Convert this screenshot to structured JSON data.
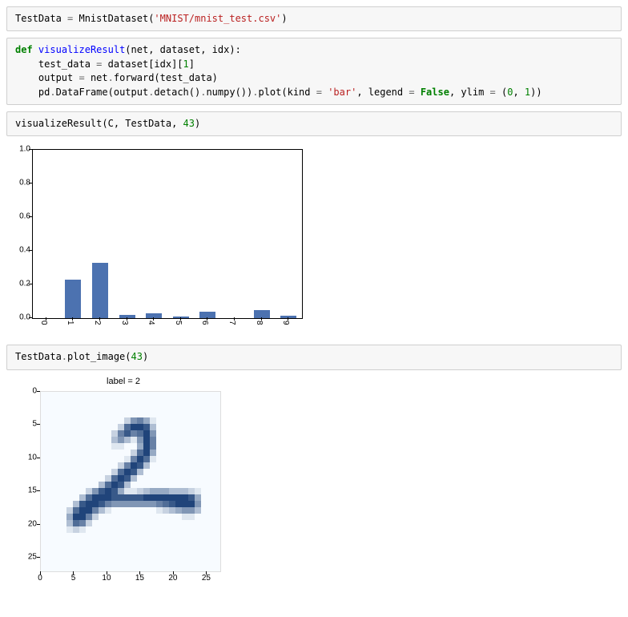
{
  "cell1": {
    "var1": "TestData",
    "eq": " = ",
    "cls": "MnistDataset",
    "lp": "(",
    "path": "'MNIST/mnist_test.csv'",
    "rp": ")"
  },
  "cell2": {
    "kw_def": "def",
    "sp": " ",
    "fname": "visualizeResult",
    "sig_open": "(net, dataset, idx):",
    "line2a": "    test_data ",
    "line2_eq": "=",
    "line2b": " dataset[idx][",
    "line2_idx": "1",
    "line2c": "]",
    "line3a": "    output ",
    "line3_eq": "=",
    "line3b": " net",
    "line3_dot": ".",
    "line3_fwd": "forward(test_data)",
    "line4a": "    pd",
    "line4_dot": ".",
    "line4b": "DataFrame(output",
    "line4_dot2": ".",
    "line4c": "detach()",
    "line4_dot3": ".",
    "line4d": "numpy())",
    "line4_dot4": ".",
    "line4e": "plot(kind ",
    "line4_eq": "=",
    "line4f": " ",
    "line4_bar": "'bar'",
    "line4g": ", legend ",
    "line4_eq2": "=",
    "line4h": " ",
    "line4_false": "False",
    "line4i": ", ylim ",
    "line4_eq3": "=",
    "line4j": " (",
    "line4_zero": "0",
    "line4k": ", ",
    "line4_one": "1",
    "line4l": "))"
  },
  "cell3": {
    "text_a": "visualizeResult(C, TestData, ",
    "num": "43",
    "text_b": ")"
  },
  "cell4": {
    "text_a": "TestData",
    "dot": ".",
    "text_b": "plot_image(",
    "num": "43",
    "text_c": ")"
  },
  "chart_data": [
    {
      "type": "bar",
      "title": "",
      "xlabel": "",
      "ylabel": "",
      "ylim": [
        0,
        1.0
      ],
      "yticks": [
        0.0,
        0.2,
        0.4,
        0.6,
        0.8,
        1.0
      ],
      "categories": [
        "0",
        "1",
        "2",
        "3",
        "4",
        "5",
        "6",
        "7",
        "8",
        "9"
      ],
      "values": [
        0.0,
        0.23,
        0.33,
        0.02,
        0.03,
        0.01,
        0.04,
        0.0,
        0.05,
        0.015
      ]
    },
    {
      "type": "heatmap",
      "title": "label = 2",
      "xticks": [
        0,
        5,
        10,
        15,
        20,
        25
      ],
      "yticks": [
        0,
        5,
        10,
        15,
        20,
        25
      ],
      "rows": 28,
      "cols": 28,
      "colormap": "Blues",
      "description": "28x28 MNIST grayscale image of handwritten digit '2'; pixel intensities approximate, background ~0, foreground strokes 0.5-1.0",
      "pixels": [
        [
          0,
          0,
          0,
          0,
          0,
          0,
          0,
          0,
          0,
          0,
          0,
          0,
          0,
          0,
          0,
          0,
          0,
          0,
          0,
          0,
          0,
          0,
          0,
          0,
          0,
          0,
          0,
          0
        ],
        [
          0,
          0,
          0,
          0,
          0,
          0,
          0,
          0,
          0,
          0,
          0,
          0,
          0,
          0,
          0,
          0,
          0,
          0,
          0,
          0,
          0,
          0,
          0,
          0,
          0,
          0,
          0,
          0
        ],
        [
          0,
          0,
          0,
          0,
          0,
          0,
          0,
          0,
          0,
          0,
          0,
          0,
          0,
          0,
          0,
          0,
          0,
          0,
          0,
          0,
          0,
          0,
          0,
          0,
          0,
          0,
          0,
          0
        ],
        [
          0,
          0,
          0,
          0,
          0,
          0,
          0,
          0,
          0,
          0,
          0,
          0,
          0,
          0,
          0,
          0,
          0,
          0,
          0,
          0,
          0,
          0,
          0,
          0,
          0,
          0,
          0,
          0
        ],
        [
          0,
          0,
          0,
          0,
          0,
          0,
          0,
          0,
          0,
          0,
          0,
          0,
          0,
          0.2,
          0.5,
          0.6,
          0.4,
          0.1,
          0,
          0,
          0,
          0,
          0,
          0,
          0,
          0,
          0,
          0
        ],
        [
          0,
          0,
          0,
          0,
          0,
          0,
          0,
          0,
          0,
          0,
          0,
          0,
          0.2,
          0.7,
          0.9,
          0.9,
          0.8,
          0.3,
          0,
          0,
          0,
          0,
          0,
          0,
          0,
          0,
          0,
          0
        ],
        [
          0,
          0,
          0,
          0,
          0,
          0,
          0,
          0,
          0,
          0,
          0,
          0.2,
          0.6,
          0.8,
          0.6,
          0.7,
          0.9,
          0.5,
          0,
          0,
          0,
          0,
          0,
          0,
          0,
          0,
          0,
          0
        ],
        [
          0,
          0,
          0,
          0,
          0,
          0,
          0,
          0,
          0,
          0,
          0,
          0.3,
          0.5,
          0.3,
          0.1,
          0.5,
          0.9,
          0.6,
          0,
          0,
          0,
          0,
          0,
          0,
          0,
          0,
          0,
          0
        ],
        [
          0,
          0,
          0,
          0,
          0,
          0,
          0,
          0,
          0,
          0,
          0,
          0.1,
          0.1,
          0,
          0,
          0.4,
          0.9,
          0.6,
          0,
          0,
          0,
          0,
          0,
          0,
          0,
          0,
          0,
          0
        ],
        [
          0,
          0,
          0,
          0,
          0,
          0,
          0,
          0,
          0,
          0,
          0,
          0,
          0,
          0,
          0.2,
          0.7,
          0.9,
          0.4,
          0,
          0,
          0,
          0,
          0,
          0,
          0,
          0,
          0,
          0
        ],
        [
          0,
          0,
          0,
          0,
          0,
          0,
          0,
          0,
          0,
          0,
          0,
          0,
          0,
          0.1,
          0.6,
          0.9,
          0.7,
          0.1,
          0,
          0,
          0,
          0,
          0,
          0,
          0,
          0,
          0,
          0
        ],
        [
          0,
          0,
          0,
          0,
          0,
          0,
          0,
          0,
          0,
          0,
          0,
          0,
          0.2,
          0.6,
          0.9,
          0.8,
          0.3,
          0,
          0,
          0,
          0,
          0,
          0,
          0,
          0,
          0,
          0,
          0
        ],
        [
          0,
          0,
          0,
          0,
          0,
          0,
          0,
          0,
          0,
          0,
          0,
          0.2,
          0.7,
          0.9,
          0.8,
          0.3,
          0,
          0,
          0,
          0,
          0,
          0,
          0,
          0,
          0,
          0,
          0,
          0
        ],
        [
          0,
          0,
          0,
          0,
          0,
          0,
          0,
          0,
          0,
          0,
          0.2,
          0.7,
          0.9,
          0.8,
          0.3,
          0,
          0,
          0,
          0,
          0,
          0,
          0,
          0,
          0,
          0,
          0,
          0,
          0
        ],
        [
          0,
          0,
          0,
          0,
          0,
          0,
          0,
          0,
          0,
          0.3,
          0.7,
          0.9,
          0.8,
          0.3,
          0,
          0,
          0,
          0,
          0,
          0,
          0,
          0,
          0,
          0,
          0,
          0,
          0,
          0
        ],
        [
          0,
          0,
          0,
          0,
          0,
          0,
          0,
          0.2,
          0.5,
          0.8,
          0.9,
          0.8,
          0.4,
          0.1,
          0.1,
          0.2,
          0.3,
          0.4,
          0.4,
          0.4,
          0.3,
          0.3,
          0.3,
          0.2,
          0.1,
          0,
          0,
          0
        ],
        [
          0,
          0,
          0,
          0,
          0,
          0,
          0.3,
          0.7,
          0.9,
          0.9,
          0.9,
          0.8,
          0.8,
          0.8,
          0.8,
          0.8,
          0.9,
          0.9,
          0.9,
          0.9,
          0.9,
          0.9,
          0.9,
          0.8,
          0.4,
          0,
          0,
          0
        ],
        [
          0,
          0,
          0,
          0,
          0,
          0.3,
          0.8,
          0.9,
          0.9,
          0.8,
          0.6,
          0.5,
          0.5,
          0.5,
          0.5,
          0.5,
          0.5,
          0.5,
          0.6,
          0.7,
          0.8,
          0.9,
          0.9,
          0.9,
          0.5,
          0,
          0,
          0
        ],
        [
          0,
          0,
          0,
          0,
          0.2,
          0.7,
          0.9,
          0.9,
          0.6,
          0.3,
          0.1,
          0,
          0,
          0,
          0,
          0,
          0,
          0,
          0.1,
          0.2,
          0.3,
          0.4,
          0.5,
          0.5,
          0.3,
          0,
          0,
          0
        ],
        [
          0,
          0,
          0,
          0,
          0.4,
          0.9,
          0.9,
          0.6,
          0.2,
          0,
          0,
          0,
          0,
          0,
          0,
          0,
          0,
          0,
          0,
          0,
          0,
          0,
          0.1,
          0.1,
          0,
          0,
          0,
          0
        ],
        [
          0,
          0,
          0,
          0,
          0.3,
          0.7,
          0.6,
          0.2,
          0,
          0,
          0,
          0,
          0,
          0,
          0,
          0,
          0,
          0,
          0,
          0,
          0,
          0,
          0,
          0,
          0,
          0,
          0,
          0
        ],
        [
          0,
          0,
          0,
          0,
          0.1,
          0.2,
          0.1,
          0,
          0,
          0,
          0,
          0,
          0,
          0,
          0,
          0,
          0,
          0,
          0,
          0,
          0,
          0,
          0,
          0,
          0,
          0,
          0,
          0
        ],
        [
          0,
          0,
          0,
          0,
          0,
          0,
          0,
          0,
          0,
          0,
          0,
          0,
          0,
          0,
          0,
          0,
          0,
          0,
          0,
          0,
          0,
          0,
          0,
          0,
          0,
          0,
          0,
          0
        ],
        [
          0,
          0,
          0,
          0,
          0,
          0,
          0,
          0,
          0,
          0,
          0,
          0,
          0,
          0,
          0,
          0,
          0,
          0,
          0,
          0,
          0,
          0,
          0,
          0,
          0,
          0,
          0,
          0
        ],
        [
          0,
          0,
          0,
          0,
          0,
          0,
          0,
          0,
          0,
          0,
          0,
          0,
          0,
          0,
          0,
          0,
          0,
          0,
          0,
          0,
          0,
          0,
          0,
          0,
          0,
          0,
          0,
          0
        ],
        [
          0,
          0,
          0,
          0,
          0,
          0,
          0,
          0,
          0,
          0,
          0,
          0,
          0,
          0,
          0,
          0,
          0,
          0,
          0,
          0,
          0,
          0,
          0,
          0,
          0,
          0,
          0,
          0
        ],
        [
          0,
          0,
          0,
          0,
          0,
          0,
          0,
          0,
          0,
          0,
          0,
          0,
          0,
          0,
          0,
          0,
          0,
          0,
          0,
          0,
          0,
          0,
          0,
          0,
          0,
          0,
          0,
          0
        ],
        [
          0,
          0,
          0,
          0,
          0,
          0,
          0,
          0,
          0,
          0,
          0,
          0,
          0,
          0,
          0,
          0,
          0,
          0,
          0,
          0,
          0,
          0,
          0,
          0,
          0,
          0,
          0,
          0
        ]
      ]
    }
  ],
  "yticks_fmt": [
    "0.0",
    "0.2",
    "0.4",
    "0.6",
    "0.8",
    "1.0"
  ]
}
